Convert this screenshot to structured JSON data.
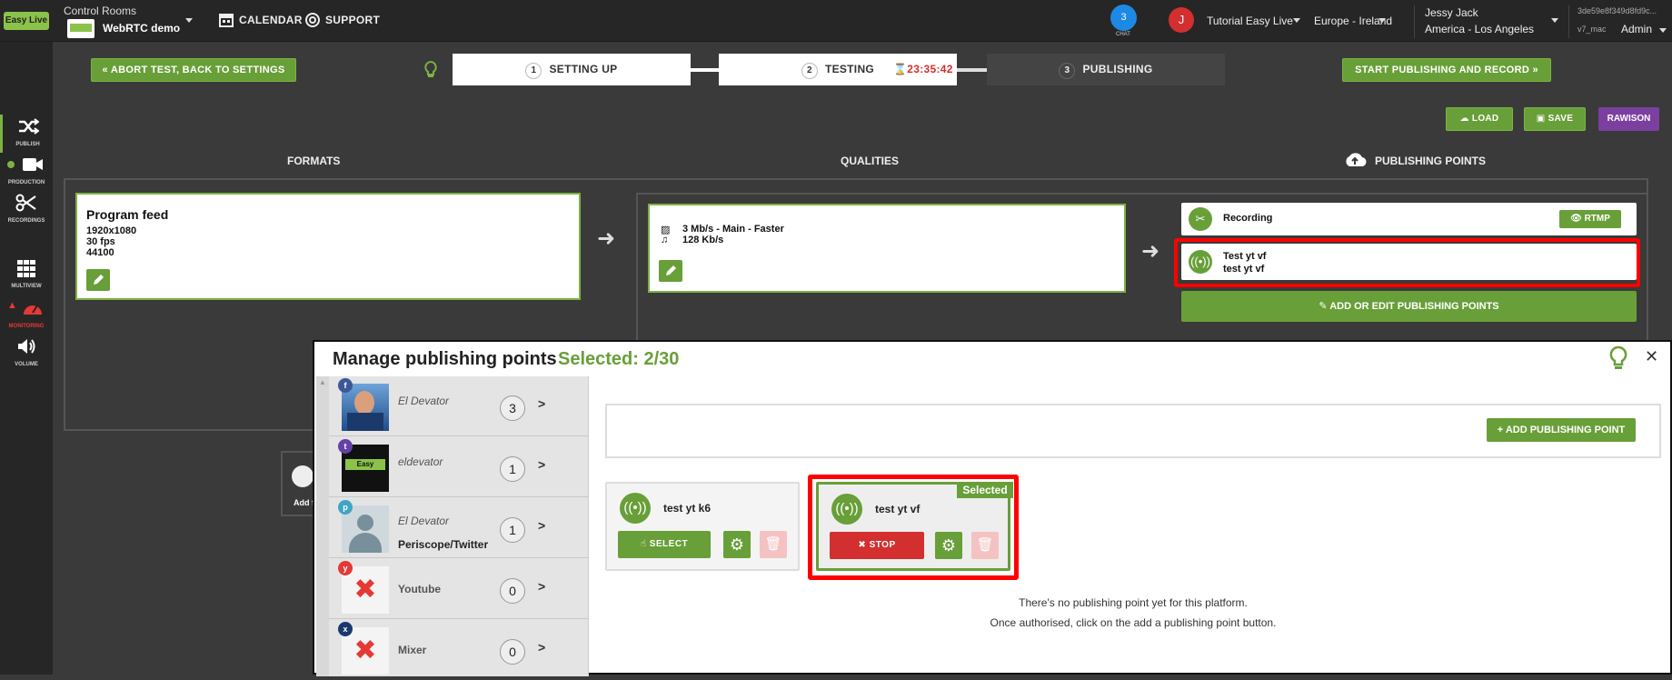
{
  "topbar": {
    "logo": "Easy Live",
    "control_rooms_label": "Control Rooms",
    "room_name": "WebRTC demo",
    "calendar_label": "CALENDAR",
    "support_label": "SUPPORT",
    "chat_count": "3",
    "chat_label": "CHAT",
    "avatar_initial": "J",
    "tutorial_label": "Tutorial Easy Live",
    "region_label": "Europe - Ireland",
    "user_name": "Jessy Jack",
    "user_tz": "America - Los Angeles",
    "session_id": "3de59e8f349d8fd9c...",
    "version": "v7_mac",
    "role": "Admin"
  },
  "sidebar": {
    "items": [
      {
        "label": "PUBLISH",
        "icon": "shuffle-icon"
      },
      {
        "label": "PRODUCTION",
        "icon": "video-camera-icon"
      },
      {
        "label": "RECORDINGS",
        "icon": "scissors-icon"
      },
      {
        "label": "MULTIVIEW",
        "icon": "grid-icon"
      },
      {
        "label": "MONITORING",
        "icon": "gauge-icon"
      },
      {
        "label": "VOLUME",
        "icon": "speaker-icon"
      }
    ]
  },
  "stepper": {
    "abort_label": "« ABORT TEST, BACK TO SETTINGS",
    "steps": [
      {
        "num": "1",
        "label": "SETTING UP"
      },
      {
        "num": "2",
        "label": "TESTING"
      },
      {
        "num": "3",
        "label": "PUBLISHING"
      }
    ],
    "timer": "23:35:42",
    "start_label": "START PUBLISHING AND RECORD »"
  },
  "toolbar": {
    "load_label": "LOAD",
    "save_label": "SAVE",
    "profile_label": "RAWISON"
  },
  "columns": {
    "formats": "FORMATS",
    "qualities": "QUALITIES",
    "publishing_points": "PUBLISHING POINTS"
  },
  "format": {
    "title": "Program feed",
    "resolution": "1920x1080",
    "fps": "30 fps",
    "sample_rate": "44100"
  },
  "quality": {
    "video": "3 Mb/s  -  Main  -  Faster",
    "audio": "128 Kb/s"
  },
  "publishing_points": {
    "recording_label": "Recording",
    "rtmp_label": "RTMP",
    "test_title": "Test yt vf",
    "test_sub": "test yt vf",
    "add_edit_label": "ADD OR EDIT PUBLISHING POINTS"
  },
  "add_partial": "Add f",
  "modal": {
    "title": "Manage publishing points",
    "selected": "Selected: 2/30",
    "platforms": [
      {
        "name": "El Devator",
        "sub": "",
        "count": "3",
        "badge": "f",
        "badge_color": "#3b5998"
      },
      {
        "name": "eldevator",
        "sub": "",
        "count": "1",
        "badge": "t",
        "badge_color": "#6441a5"
      },
      {
        "name": "El Devator",
        "sub": "Periscope/Twitter",
        "count": "1",
        "badge": "p",
        "badge_color": "#40a4c4"
      },
      {
        "name": "Youtube",
        "sub": "",
        "count": "0",
        "badge": "y",
        "badge_color": "#e53935"
      },
      {
        "name": "Mixer",
        "sub": "",
        "count": "0",
        "badge": "x",
        "badge_color": "#1a3a6e"
      }
    ],
    "add_point_label": "+ ADD PUBLISHING POINT",
    "cards": [
      {
        "name": "test yt k6",
        "action": "SELECT",
        "selected": false
      },
      {
        "name": "test yt vf",
        "action": "STOP",
        "selected": true,
        "tag": "Selected"
      }
    ],
    "empty_line1": "There's no publishing point yet for this platform.",
    "empty_line2": "Once authorised, click on the add a publishing point button."
  },
  "colors": {
    "accent_green": "#689f38",
    "danger_red": "#d32f2f",
    "highlight_red": "#ff0000",
    "purple": "#7b3fa0"
  }
}
